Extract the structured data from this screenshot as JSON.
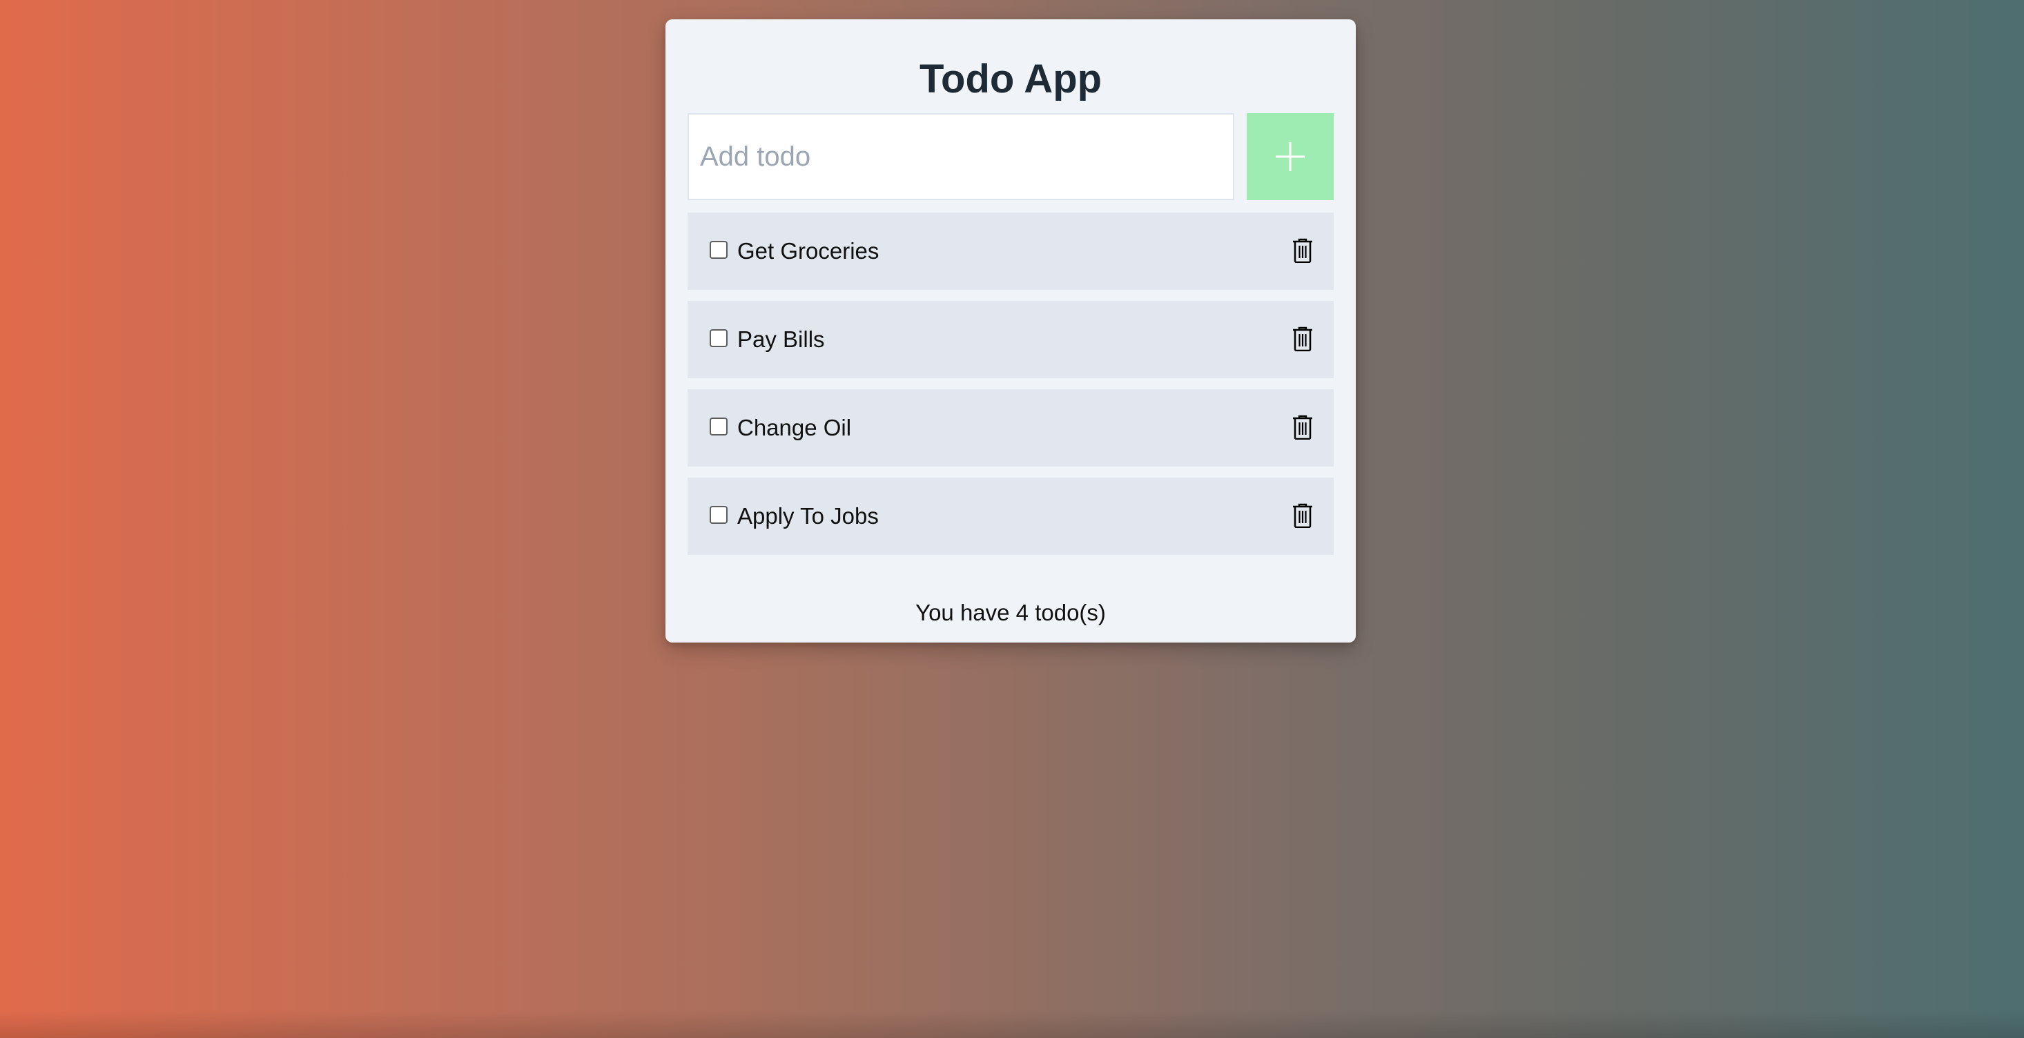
{
  "app": {
    "title": "Todo App"
  },
  "input": {
    "placeholder": "Add todo",
    "value": "",
    "add_icon": "plus-icon",
    "add_button_color": "#9fecb2"
  },
  "todos": [
    {
      "label": "Get Groceries",
      "checked": false,
      "delete_icon": "trash-icon"
    },
    {
      "label": "Pay Bills",
      "checked": false,
      "delete_icon": "trash-icon"
    },
    {
      "label": "Change Oil",
      "checked": false,
      "delete_icon": "trash-icon"
    },
    {
      "label": "Apply To Jobs",
      "checked": false,
      "delete_icon": "trash-icon"
    }
  ],
  "footer": {
    "count_text": "You have 4 todo(s)"
  },
  "colors": {
    "card_background": "#f0f4f8",
    "item_background": "#e2e7ee",
    "title_color": "#1e2a36"
  }
}
